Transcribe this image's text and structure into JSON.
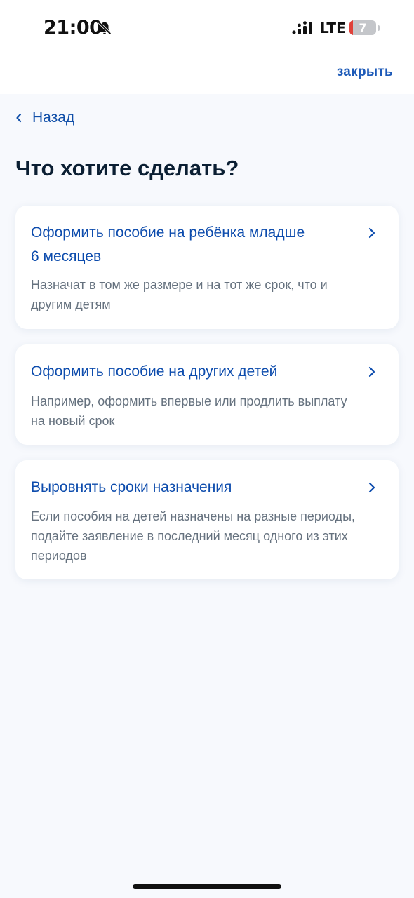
{
  "status_bar": {
    "time": "21:00",
    "network": "LTE",
    "battery": "7",
    "bell_icon": "bell-slash-icon"
  },
  "top_bar": {
    "close_label": "закрыть"
  },
  "nav": {
    "back_label": "Назад"
  },
  "page": {
    "title": "Что хотите сделать?"
  },
  "options": [
    {
      "title_line1": "Оформить пособие на ребёнка младше",
      "title_line2": "6 месяцев",
      "desc_line1": "Назначат в том же размере и на тот же срок, что и",
      "desc_line2": "другим детям"
    },
    {
      "title": "Оформить пособие на других детей",
      "desc_line1": "Например, оформить впервые или продлить выплату",
      "desc_line2": "на новый срок"
    },
    {
      "title": "Выровнять сроки назначения",
      "desc_line1": "Если пособия на детей назначены на разные периоды,",
      "desc_line2": "подайте заявление в последний месяц одного из этих",
      "desc_line3": "периодов"
    }
  ],
  "colors": {
    "accent": "#0d4cad",
    "background": "#f7f9fd",
    "muted_text": "#66727f"
  }
}
